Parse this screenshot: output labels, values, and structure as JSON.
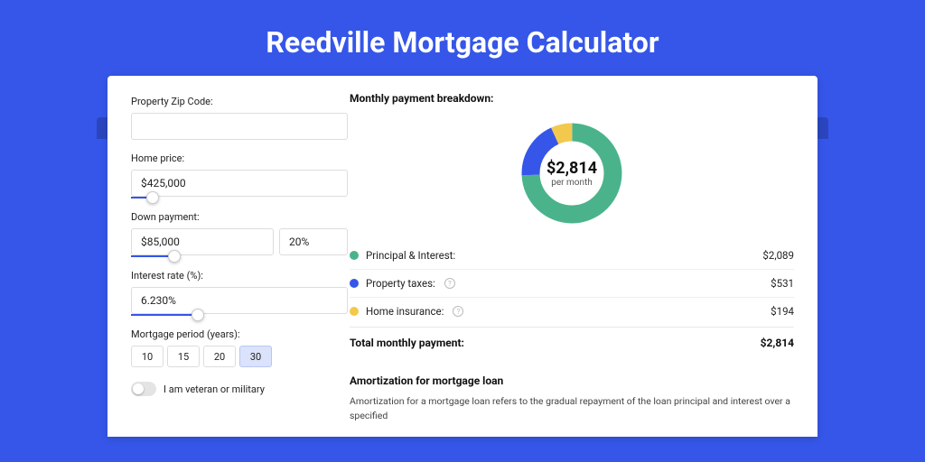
{
  "page_title": "Reedville Mortgage Calculator",
  "form": {
    "zip_label": "Property Zip Code:",
    "zip_value": "",
    "home_price_label": "Home price:",
    "home_price_value": "$425,000",
    "home_price_slider_pct": 10,
    "down_payment_label": "Down payment:",
    "down_payment_value": "$85,000",
    "down_payment_pct": "20%",
    "down_payment_slider_pct": 20,
    "interest_label": "Interest rate (%):",
    "interest_value": "6.230%",
    "interest_slider_pct": 31,
    "period_label": "Mortgage period (years):",
    "periods": [
      "10",
      "15",
      "20",
      "30"
    ],
    "period_active_index": 3,
    "veteran_label": "I am veteran or military"
  },
  "breakdown": {
    "title": "Monthly payment breakdown:",
    "total_amount": "$2,814",
    "per_month": "per month",
    "items": [
      {
        "label": "Principal & Interest:",
        "value": "$2,089",
        "color": "#4bb38b"
      },
      {
        "label": "Property taxes:",
        "value": "$531",
        "color": "#3556e8",
        "help": true
      },
      {
        "label": "Home insurance:",
        "value": "$194",
        "color": "#f2c94c",
        "help": true
      }
    ],
    "total_label": "Total monthly payment:",
    "total_value": "$2,814"
  },
  "amortization": {
    "title": "Amortization for mortgage loan",
    "text": "Amortization for a mortgage loan refers to the gradual repayment of the loan principal and interest over a specified"
  },
  "chart_data": {
    "type": "pie",
    "title": "Monthly payment breakdown",
    "series": [
      {
        "name": "Principal & Interest",
        "value": 2089,
        "color": "#4bb38b"
      },
      {
        "name": "Property taxes",
        "value": 531,
        "color": "#3556e8"
      },
      {
        "name": "Home insurance",
        "value": 194,
        "color": "#f2c94c"
      }
    ],
    "total": 2814,
    "center_label": "$2,814 per month"
  }
}
